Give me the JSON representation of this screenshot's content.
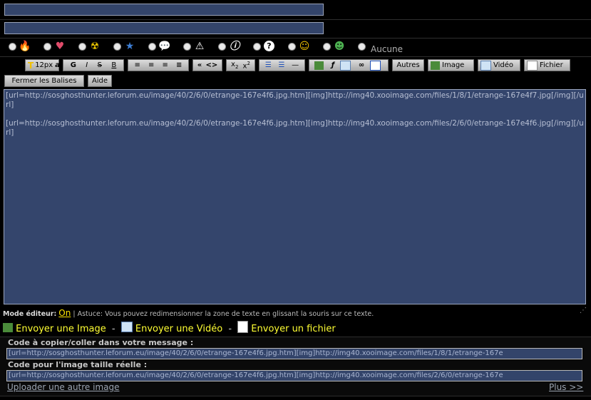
{
  "fields": {
    "title_value": "",
    "subtitle_value": ""
  },
  "icons_row": {
    "items": [
      {
        "icon": "fire-icon",
        "glyph": "🔥",
        "color": "#e05a2a"
      },
      {
        "icon": "heart-icon",
        "glyph": "♥",
        "color": "#e04b6a"
      },
      {
        "icon": "radiation-icon",
        "glyph": "☢",
        "color": "#e8c400"
      },
      {
        "icon": "star-icon",
        "glyph": "★",
        "color": "#3d7fd6"
      },
      {
        "icon": "speech-bubble-icon",
        "glyph": "💬",
        "color": "#ffffff"
      },
      {
        "icon": "warning-icon",
        "glyph": "⚠",
        "color": "#ffffff"
      },
      {
        "icon": "info-icon",
        "glyph": "ⓘ",
        "color": "#ffffff"
      },
      {
        "icon": "question-icon",
        "glyph": "?",
        "color": "#ffffff"
      },
      {
        "icon": "smiley-icon",
        "glyph": "☺",
        "color": "#f3c200"
      },
      {
        "icon": "monster-icon",
        "glyph": "☻",
        "color": "#4caf50"
      }
    ],
    "none_label": "Aucune"
  },
  "toolbar": {
    "font_size": "12px",
    "bold": "G",
    "italic": "I",
    "strike": "S",
    "underline": "B",
    "autres": "Autres",
    "image": "Image",
    "video": "Vidéo",
    "fichier": "Fichier",
    "fermer": "Fermer les Balises",
    "aide": "Aide"
  },
  "editor": {
    "content": "[url=http://sosghosthunter.leforum.eu/image/40/2/6/0/etrange-167e4f6.jpg.htm][img]http://img40.xooimage.com/files/1/8/1/etrange-167e4f7.jpg[/img][/url]\n\n[url=http://sosghosthunter.leforum.eu/image/40/2/6/0/etrange-167e4f6.jpg.htm][img]http://img40.xooimage.com/files/2/6/0/etrange-167e4f6.jpg[/img][/url]"
  },
  "mode": {
    "label": "Mode éditeur:",
    "state": "On",
    "tip": "| Astuce: Vous pouvez redimensionner la zone de texte en glissant la souris sur ce texte."
  },
  "send": {
    "image": "Envoyer une Image",
    "video": "Envoyer une Vidéo",
    "file": "Envoyer un fichier",
    "sep": "-"
  },
  "codes": {
    "copy_label": "Code à copier/coller dans votre message :",
    "copy_value": "[url=http://sosghosthunter.leforum.eu/image/40/2/6/0/etrange-167e4f6.jpg.htm][img]http://img40.xooimage.com/files/1/8/1/etrange-167e",
    "real_label": "Code pour l'image taille réelle :",
    "real_value": "[url=http://sosghosthunter.leforum.eu/image/40/2/6/0/etrange-167e4f6.jpg.htm][img]http://img40.xooimage.com/files/2/6/0/etrange-167e"
  },
  "links": {
    "upload_other": "Uploader une autre image",
    "more": "Plus >>"
  }
}
